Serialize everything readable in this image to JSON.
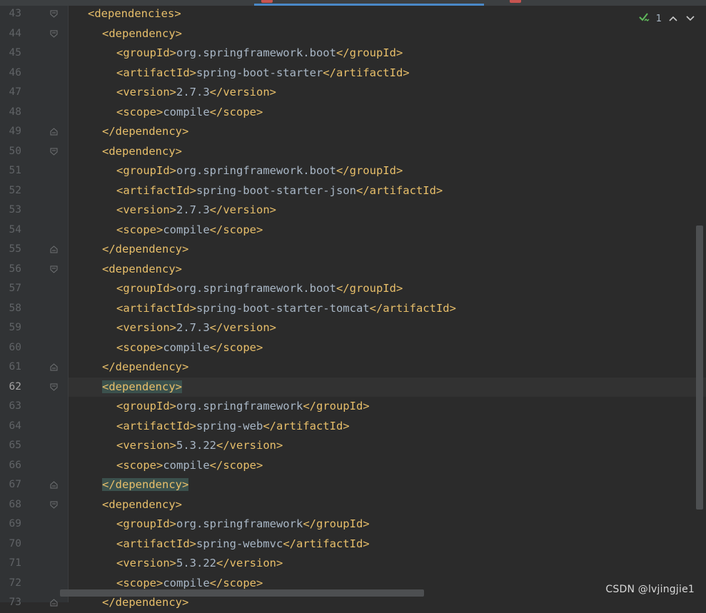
{
  "tabs": [
    {
      "label": "",
      "active": true
    },
    {
      "label": "",
      "active": false
    }
  ],
  "status": {
    "count": "1"
  },
  "watermark": "CSDN @lvjingjie1",
  "current_line": "62",
  "lines": [
    {
      "n": "43",
      "indent": 2,
      "parts": [
        {
          "t": "<dependencies>",
          "c": "tag"
        }
      ],
      "fold": "open"
    },
    {
      "n": "44",
      "indent": 4,
      "parts": [
        {
          "t": "<dependency>",
          "c": "tag"
        }
      ],
      "fold": "open"
    },
    {
      "n": "45",
      "indent": 6,
      "parts": [
        {
          "t": "<groupId>",
          "c": "tag"
        },
        {
          "t": "org.springframework.boot",
          "c": "txt"
        },
        {
          "t": "</groupId>",
          "c": "tag"
        }
      ]
    },
    {
      "n": "46",
      "indent": 6,
      "parts": [
        {
          "t": "<artifactId>",
          "c": "tag"
        },
        {
          "t": "spring-boot-starter",
          "c": "txt"
        },
        {
          "t": "</artifactId>",
          "c": "tag"
        }
      ]
    },
    {
      "n": "47",
      "indent": 6,
      "parts": [
        {
          "t": "<version>",
          "c": "tag"
        },
        {
          "t": "2.7.3",
          "c": "txt"
        },
        {
          "t": "</version>",
          "c": "tag"
        }
      ]
    },
    {
      "n": "48",
      "indent": 6,
      "parts": [
        {
          "t": "<scope>",
          "c": "tag"
        },
        {
          "t": "compile",
          "c": "txt"
        },
        {
          "t": "</scope>",
          "c": "tag"
        }
      ]
    },
    {
      "n": "49",
      "indent": 4,
      "parts": [
        {
          "t": "</dependency>",
          "c": "tag"
        }
      ],
      "fold": "close"
    },
    {
      "n": "50",
      "indent": 4,
      "parts": [
        {
          "t": "<dependency>",
          "c": "tag"
        }
      ],
      "fold": "open"
    },
    {
      "n": "51",
      "indent": 6,
      "parts": [
        {
          "t": "<groupId>",
          "c": "tag"
        },
        {
          "t": "org.springframework.boot",
          "c": "txt"
        },
        {
          "t": "</groupId>",
          "c": "tag"
        }
      ]
    },
    {
      "n": "52",
      "indent": 6,
      "parts": [
        {
          "t": "<artifactId>",
          "c": "tag"
        },
        {
          "t": "spring-boot-starter-json",
          "c": "txt"
        },
        {
          "t": "</artifactId>",
          "c": "tag"
        }
      ]
    },
    {
      "n": "53",
      "indent": 6,
      "parts": [
        {
          "t": "<version>",
          "c": "tag"
        },
        {
          "t": "2.7.3",
          "c": "txt"
        },
        {
          "t": "</version>",
          "c": "tag"
        }
      ]
    },
    {
      "n": "54",
      "indent": 6,
      "parts": [
        {
          "t": "<scope>",
          "c": "tag"
        },
        {
          "t": "compile",
          "c": "txt"
        },
        {
          "t": "</scope>",
          "c": "tag"
        }
      ]
    },
    {
      "n": "55",
      "indent": 4,
      "parts": [
        {
          "t": "</dependency>",
          "c": "tag"
        }
      ],
      "fold": "close"
    },
    {
      "n": "56",
      "indent": 4,
      "parts": [
        {
          "t": "<dependency>",
          "c": "tag"
        }
      ],
      "fold": "open"
    },
    {
      "n": "57",
      "indent": 6,
      "parts": [
        {
          "t": "<groupId>",
          "c": "tag"
        },
        {
          "t": "org.springframework.boot",
          "c": "txt"
        },
        {
          "t": "</groupId>",
          "c": "tag"
        }
      ]
    },
    {
      "n": "58",
      "indent": 6,
      "parts": [
        {
          "t": "<artifactId>",
          "c": "tag"
        },
        {
          "t": "spring-boot-starter-tomcat",
          "c": "txt"
        },
        {
          "t": "</artifactId>",
          "c": "tag"
        }
      ]
    },
    {
      "n": "59",
      "indent": 6,
      "parts": [
        {
          "t": "<version>",
          "c": "tag"
        },
        {
          "t": "2.7.3",
          "c": "txt"
        },
        {
          "t": "</version>",
          "c": "tag"
        }
      ]
    },
    {
      "n": "60",
      "indent": 6,
      "parts": [
        {
          "t": "<scope>",
          "c": "tag"
        },
        {
          "t": "compile",
          "c": "txt"
        },
        {
          "t": "</scope>",
          "c": "tag"
        }
      ]
    },
    {
      "n": "61",
      "indent": 4,
      "parts": [
        {
          "t": "</dependency>",
          "c": "tag"
        }
      ],
      "fold": "close"
    },
    {
      "n": "62",
      "indent": 4,
      "parts": [
        {
          "t": "<dependency>",
          "c": "tag",
          "hl": true
        }
      ],
      "fold": "open"
    },
    {
      "n": "63",
      "indent": 6,
      "parts": [
        {
          "t": "<groupId>",
          "c": "tag"
        },
        {
          "t": "org.springframework",
          "c": "txt"
        },
        {
          "t": "</groupId>",
          "c": "tag"
        }
      ]
    },
    {
      "n": "64",
      "indent": 6,
      "parts": [
        {
          "t": "<artifactId>",
          "c": "tag"
        },
        {
          "t": "spring-web",
          "c": "txt"
        },
        {
          "t": "</artifactId>",
          "c": "tag"
        }
      ]
    },
    {
      "n": "65",
      "indent": 6,
      "parts": [
        {
          "t": "<version>",
          "c": "tag"
        },
        {
          "t": "5.3.22",
          "c": "txt"
        },
        {
          "t": "</version>",
          "c": "tag"
        }
      ]
    },
    {
      "n": "66",
      "indent": 6,
      "parts": [
        {
          "t": "<scope>",
          "c": "tag"
        },
        {
          "t": "compile",
          "c": "txt"
        },
        {
          "t": "</scope>",
          "c": "tag"
        }
      ]
    },
    {
      "n": "67",
      "indent": 4,
      "parts": [
        {
          "t": "</dependency>",
          "c": "tag",
          "hl": true
        }
      ],
      "fold": "close"
    },
    {
      "n": "68",
      "indent": 4,
      "parts": [
        {
          "t": "<dependency>",
          "c": "tag"
        }
      ],
      "fold": "open"
    },
    {
      "n": "69",
      "indent": 6,
      "parts": [
        {
          "t": "<groupId>",
          "c": "tag"
        },
        {
          "t": "org.springframework",
          "c": "txt"
        },
        {
          "t": "</groupId>",
          "c": "tag"
        }
      ]
    },
    {
      "n": "70",
      "indent": 6,
      "parts": [
        {
          "t": "<artifactId>",
          "c": "tag"
        },
        {
          "t": "spring-webmvc",
          "c": "txt"
        },
        {
          "t": "</artifactId>",
          "c": "tag"
        }
      ]
    },
    {
      "n": "71",
      "indent": 6,
      "parts": [
        {
          "t": "<version>",
          "c": "tag"
        },
        {
          "t": "5.3.22",
          "c": "txt"
        },
        {
          "t": "</version>",
          "c": "tag"
        }
      ]
    },
    {
      "n": "72",
      "indent": 6,
      "parts": [
        {
          "t": "<scope>",
          "c": "tag"
        },
        {
          "t": "compile",
          "c": "txt"
        },
        {
          "t": "</scope>",
          "c": "tag"
        }
      ]
    },
    {
      "n": "73",
      "indent": 4,
      "parts": [
        {
          "t": "</dependency>",
          "c": "tag"
        }
      ],
      "fold": "close"
    }
  ]
}
